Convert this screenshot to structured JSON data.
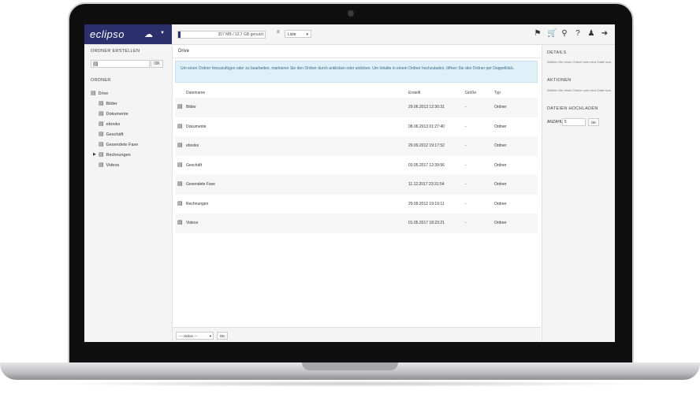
{
  "brand": {
    "logo": "eclipso",
    "cloud_icon": "cloud-icon"
  },
  "topbar": {
    "quota_text": "357 MB / 12,7 GB genutzt",
    "quota_fraction": 0.03,
    "view_label": "≡",
    "view_select": "Liste",
    "icons": [
      "bell-icon",
      "cart-icon",
      "search-icon",
      "help-icon",
      "user-icon",
      "logout-icon"
    ]
  },
  "left": {
    "new_folder_title": "ORDNER ERSTELLEN",
    "new_folder_ok": "OK",
    "folders_title": "ORDNER",
    "tree": [
      {
        "label": "Drive",
        "level": 0
      },
      {
        "label": "Bilder",
        "level": 1
      },
      {
        "label": "Dokumente",
        "level": 1
      },
      {
        "label": "ebooks",
        "level": 1
      },
      {
        "label": "Geschäft",
        "level": 1
      },
      {
        "label": "Gesendete Faxe",
        "level": 1
      },
      {
        "label": "Rechnungen",
        "level": 1,
        "expandable": true
      },
      {
        "label": "Videos",
        "level": 1
      }
    ]
  },
  "main": {
    "breadcrumb": "Drive",
    "info": "Um einen Ordner hinzuzufügen oder zu bearbeiten, markieren Sie den Ordner durch anklicken oder anticken. Um Inhalte in einem Ordner hochzuladen, öffnen Sie den Ordner per Doppelklick.",
    "columns": {
      "name": "Dateiname",
      "created": "Erstellt",
      "size": "Größe",
      "type": "Typ"
    },
    "rows": [
      {
        "name": "Bilder",
        "created": "29.06.2013 12:30:31",
        "size": "-",
        "type": "Ordner"
      },
      {
        "name": "Dokumente",
        "created": "08.06.2013 01:27:40",
        "size": "-",
        "type": "Ordner"
      },
      {
        "name": "ebooks",
        "created": "29.09.2012 19:17:52",
        "size": "-",
        "type": "Ordner"
      },
      {
        "name": "Geschäft",
        "created": "03.05.2017 12:39:56",
        "size": "-",
        "type": "Ordner"
      },
      {
        "name": "Gesendete Faxe",
        "created": "11.12.2017 23:31:54",
        "size": "-",
        "type": "Ordner"
      },
      {
        "name": "Rechnungen",
        "created": "29.09.2012 19:19:11",
        "size": "-",
        "type": "Ordner"
      },
      {
        "name": "Videos",
        "created": "01.05.2017 18:23:21",
        "size": "-",
        "type": "Ordner"
      }
    ],
    "action_select": "--- Aktion ---",
    "action_ok": "OK"
  },
  "right": {
    "details_title": "DETAILS",
    "details_text": "Wählen Sie einen Ordner oder eine Datei aus.",
    "actions_title": "AKTIONEN",
    "actions_text": "Wählen Sie einen Ordner oder eine Datei aus.",
    "upload_title": "DATEIEN HOCHLADEN",
    "anzahl_label": "ANZAHL",
    "anzahl_value": "5",
    "upload_ok": "OK"
  }
}
